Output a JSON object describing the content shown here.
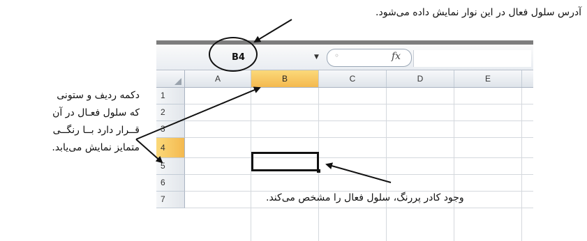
{
  "formula_bar": {
    "name_box_value": "B4",
    "fx_symbol": "fx",
    "cancel_symbol": "◦"
  },
  "columns": [
    "A",
    "B",
    "C",
    "D",
    "E"
  ],
  "rows": [
    "1",
    "2",
    "3",
    "4",
    "5",
    "6",
    "7"
  ],
  "active_cell": {
    "column": "B",
    "row": "4"
  },
  "annotations": {
    "top": "آدرس سلول فعال در این نوار نمایش داده می‌شود.",
    "left": [
      "دکمه ردیف و ستونی",
      "که سلول فعـال در آن",
      "قــرار دارد بــا رنگــی",
      "متمایز نمایش می‌یابد."
    ],
    "right": "وجود کادر پررنگ، سلول فعال را مشخص می‌کند."
  },
  "colors": {
    "active_header": "#f4b94f",
    "active_cell_border": "#111111"
  }
}
